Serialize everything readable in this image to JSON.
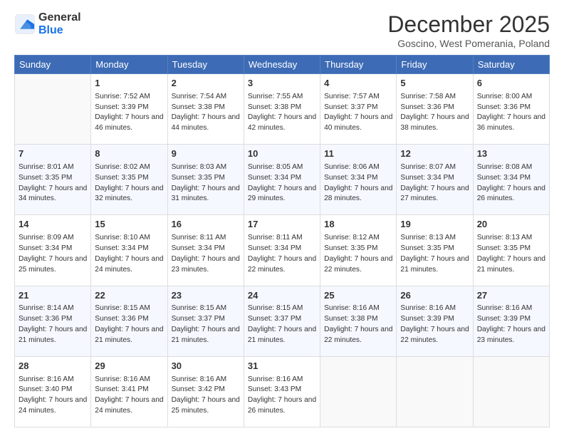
{
  "logo": {
    "general": "General",
    "blue": "Blue"
  },
  "title": "December 2025",
  "location": "Goscino, West Pomerania, Poland",
  "days_header": [
    "Sunday",
    "Monday",
    "Tuesday",
    "Wednesday",
    "Thursday",
    "Friday",
    "Saturday"
  ],
  "weeks": [
    [
      {
        "num": "",
        "sunrise": "",
        "sunset": "",
        "daylight": ""
      },
      {
        "num": "1",
        "sunrise": "Sunrise: 7:52 AM",
        "sunset": "Sunset: 3:39 PM",
        "daylight": "Daylight: 7 hours and 46 minutes."
      },
      {
        "num": "2",
        "sunrise": "Sunrise: 7:54 AM",
        "sunset": "Sunset: 3:38 PM",
        "daylight": "Daylight: 7 hours and 44 minutes."
      },
      {
        "num": "3",
        "sunrise": "Sunrise: 7:55 AM",
        "sunset": "Sunset: 3:38 PM",
        "daylight": "Daylight: 7 hours and 42 minutes."
      },
      {
        "num": "4",
        "sunrise": "Sunrise: 7:57 AM",
        "sunset": "Sunset: 3:37 PM",
        "daylight": "Daylight: 7 hours and 40 minutes."
      },
      {
        "num": "5",
        "sunrise": "Sunrise: 7:58 AM",
        "sunset": "Sunset: 3:36 PM",
        "daylight": "Daylight: 7 hours and 38 minutes."
      },
      {
        "num": "6",
        "sunrise": "Sunrise: 8:00 AM",
        "sunset": "Sunset: 3:36 PM",
        "daylight": "Daylight: 7 hours and 36 minutes."
      }
    ],
    [
      {
        "num": "7",
        "sunrise": "Sunrise: 8:01 AM",
        "sunset": "Sunset: 3:35 PM",
        "daylight": "Daylight: 7 hours and 34 minutes."
      },
      {
        "num": "8",
        "sunrise": "Sunrise: 8:02 AM",
        "sunset": "Sunset: 3:35 PM",
        "daylight": "Daylight: 7 hours and 32 minutes."
      },
      {
        "num": "9",
        "sunrise": "Sunrise: 8:03 AM",
        "sunset": "Sunset: 3:35 PM",
        "daylight": "Daylight: 7 hours and 31 minutes."
      },
      {
        "num": "10",
        "sunrise": "Sunrise: 8:05 AM",
        "sunset": "Sunset: 3:34 PM",
        "daylight": "Daylight: 7 hours and 29 minutes."
      },
      {
        "num": "11",
        "sunrise": "Sunrise: 8:06 AM",
        "sunset": "Sunset: 3:34 PM",
        "daylight": "Daylight: 7 hours and 28 minutes."
      },
      {
        "num": "12",
        "sunrise": "Sunrise: 8:07 AM",
        "sunset": "Sunset: 3:34 PM",
        "daylight": "Daylight: 7 hours and 27 minutes."
      },
      {
        "num": "13",
        "sunrise": "Sunrise: 8:08 AM",
        "sunset": "Sunset: 3:34 PM",
        "daylight": "Daylight: 7 hours and 26 minutes."
      }
    ],
    [
      {
        "num": "14",
        "sunrise": "Sunrise: 8:09 AM",
        "sunset": "Sunset: 3:34 PM",
        "daylight": "Daylight: 7 hours and 25 minutes."
      },
      {
        "num": "15",
        "sunrise": "Sunrise: 8:10 AM",
        "sunset": "Sunset: 3:34 PM",
        "daylight": "Daylight: 7 hours and 24 minutes."
      },
      {
        "num": "16",
        "sunrise": "Sunrise: 8:11 AM",
        "sunset": "Sunset: 3:34 PM",
        "daylight": "Daylight: 7 hours and 23 minutes."
      },
      {
        "num": "17",
        "sunrise": "Sunrise: 8:11 AM",
        "sunset": "Sunset: 3:34 PM",
        "daylight": "Daylight: 7 hours and 22 minutes."
      },
      {
        "num": "18",
        "sunrise": "Sunrise: 8:12 AM",
        "sunset": "Sunset: 3:35 PM",
        "daylight": "Daylight: 7 hours and 22 minutes."
      },
      {
        "num": "19",
        "sunrise": "Sunrise: 8:13 AM",
        "sunset": "Sunset: 3:35 PM",
        "daylight": "Daylight: 7 hours and 21 minutes."
      },
      {
        "num": "20",
        "sunrise": "Sunrise: 8:13 AM",
        "sunset": "Sunset: 3:35 PM",
        "daylight": "Daylight: 7 hours and 21 minutes."
      }
    ],
    [
      {
        "num": "21",
        "sunrise": "Sunrise: 8:14 AM",
        "sunset": "Sunset: 3:36 PM",
        "daylight": "Daylight: 7 hours and 21 minutes."
      },
      {
        "num": "22",
        "sunrise": "Sunrise: 8:15 AM",
        "sunset": "Sunset: 3:36 PM",
        "daylight": "Daylight: 7 hours and 21 minutes."
      },
      {
        "num": "23",
        "sunrise": "Sunrise: 8:15 AM",
        "sunset": "Sunset: 3:37 PM",
        "daylight": "Daylight: 7 hours and 21 minutes."
      },
      {
        "num": "24",
        "sunrise": "Sunrise: 8:15 AM",
        "sunset": "Sunset: 3:37 PM",
        "daylight": "Daylight: 7 hours and 21 minutes."
      },
      {
        "num": "25",
        "sunrise": "Sunrise: 8:16 AM",
        "sunset": "Sunset: 3:38 PM",
        "daylight": "Daylight: 7 hours and 22 minutes."
      },
      {
        "num": "26",
        "sunrise": "Sunrise: 8:16 AM",
        "sunset": "Sunset: 3:39 PM",
        "daylight": "Daylight: 7 hours and 22 minutes."
      },
      {
        "num": "27",
        "sunrise": "Sunrise: 8:16 AM",
        "sunset": "Sunset: 3:39 PM",
        "daylight": "Daylight: 7 hours and 23 minutes."
      }
    ],
    [
      {
        "num": "28",
        "sunrise": "Sunrise: 8:16 AM",
        "sunset": "Sunset: 3:40 PM",
        "daylight": "Daylight: 7 hours and 24 minutes."
      },
      {
        "num": "29",
        "sunrise": "Sunrise: 8:16 AM",
        "sunset": "Sunset: 3:41 PM",
        "daylight": "Daylight: 7 hours and 24 minutes."
      },
      {
        "num": "30",
        "sunrise": "Sunrise: 8:16 AM",
        "sunset": "Sunset: 3:42 PM",
        "daylight": "Daylight: 7 hours and 25 minutes."
      },
      {
        "num": "31",
        "sunrise": "Sunrise: 8:16 AM",
        "sunset": "Sunset: 3:43 PM",
        "daylight": "Daylight: 7 hours and 26 minutes."
      },
      {
        "num": "",
        "sunrise": "",
        "sunset": "",
        "daylight": ""
      },
      {
        "num": "",
        "sunrise": "",
        "sunset": "",
        "daylight": ""
      },
      {
        "num": "",
        "sunrise": "",
        "sunset": "",
        "daylight": ""
      }
    ]
  ]
}
